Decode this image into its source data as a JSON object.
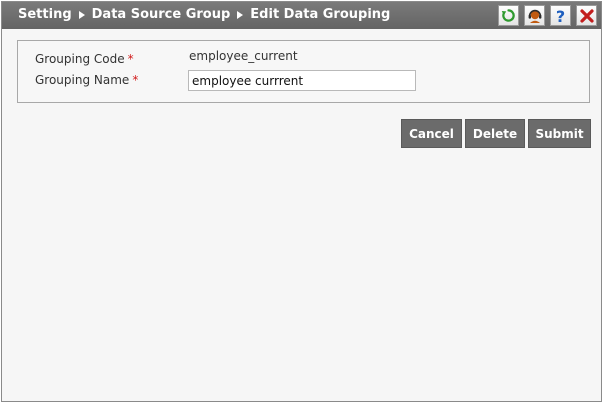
{
  "breadcrumb": {
    "items": [
      "Setting",
      "Data Source Group",
      "Edit Data Grouping"
    ]
  },
  "toolbar": {
    "icons": [
      "refresh-icon",
      "support-agent-icon",
      "help-icon",
      "close-icon"
    ],
    "colors": {
      "refresh": "#2e9a2e",
      "support": "#c05a10",
      "help": "#1f5fbf",
      "close": "#c21d1d"
    }
  },
  "form": {
    "grouping_code": {
      "label": "Grouping Code",
      "required_mark": "*",
      "value": "employee_current"
    },
    "grouping_name": {
      "label": "Grouping Name",
      "required_mark": "*",
      "value": "employee currrent"
    }
  },
  "actions": {
    "cancel_label": "Cancel",
    "delete_label": "Delete",
    "submit_label": "Submit"
  }
}
